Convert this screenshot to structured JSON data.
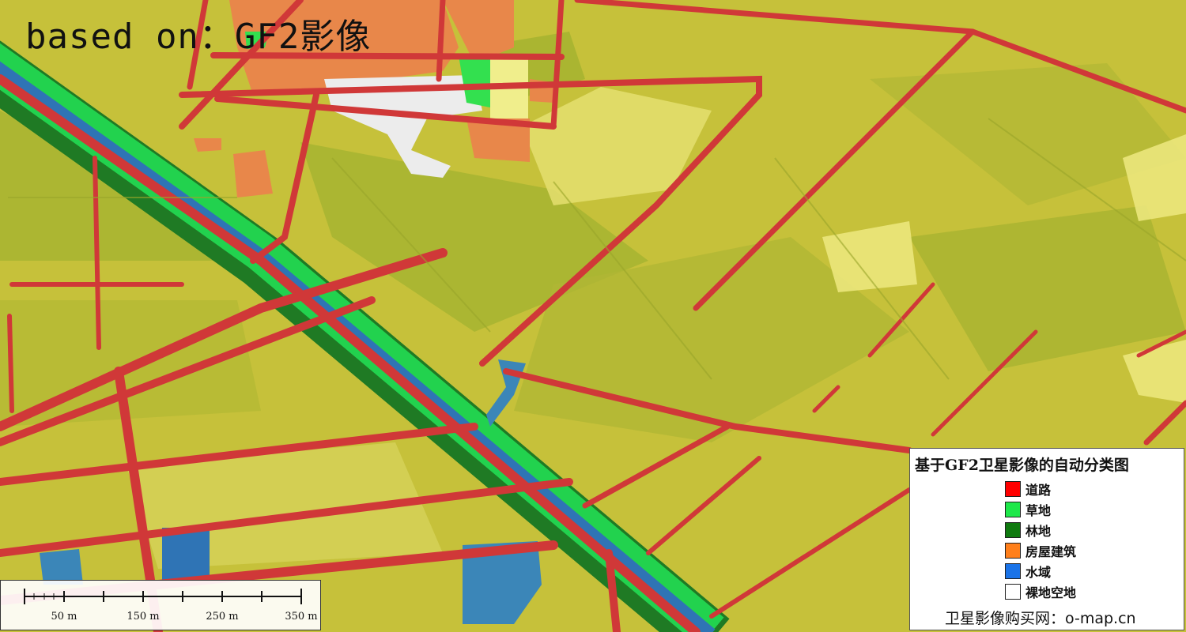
{
  "header": {
    "title": "based on：GF2影像"
  },
  "legend": {
    "title": "基于GF2卫星影像的自动分类图",
    "items": [
      {
        "label": "道路",
        "color": "#ff0000"
      },
      {
        "label": "草地",
        "color": "#1ee84a"
      },
      {
        "label": "林地",
        "color": "#0f7a0f"
      },
      {
        "label": "房屋建筑",
        "color": "#ff7f1a"
      },
      {
        "label": "水域",
        "color": "#1a73e8"
      },
      {
        "label": "裸地空地",
        "color": "#ffffff"
      }
    ],
    "footer": "卫星影像购买网：o-map.cn"
  },
  "scale": {
    "labels": [
      "50 m",
      "150 m",
      "250 m",
      "350 m"
    ]
  },
  "colors": {
    "farmland": "#c8c23a",
    "farmland_light": "#e6e16a",
    "farmland_dark": "#aeb52a",
    "road": "#d03838",
    "grass": "#22d24e",
    "forest": "#1f7a24",
    "water": "#2f74b5",
    "building": "#e8874a",
    "bare": "#ececec"
  }
}
